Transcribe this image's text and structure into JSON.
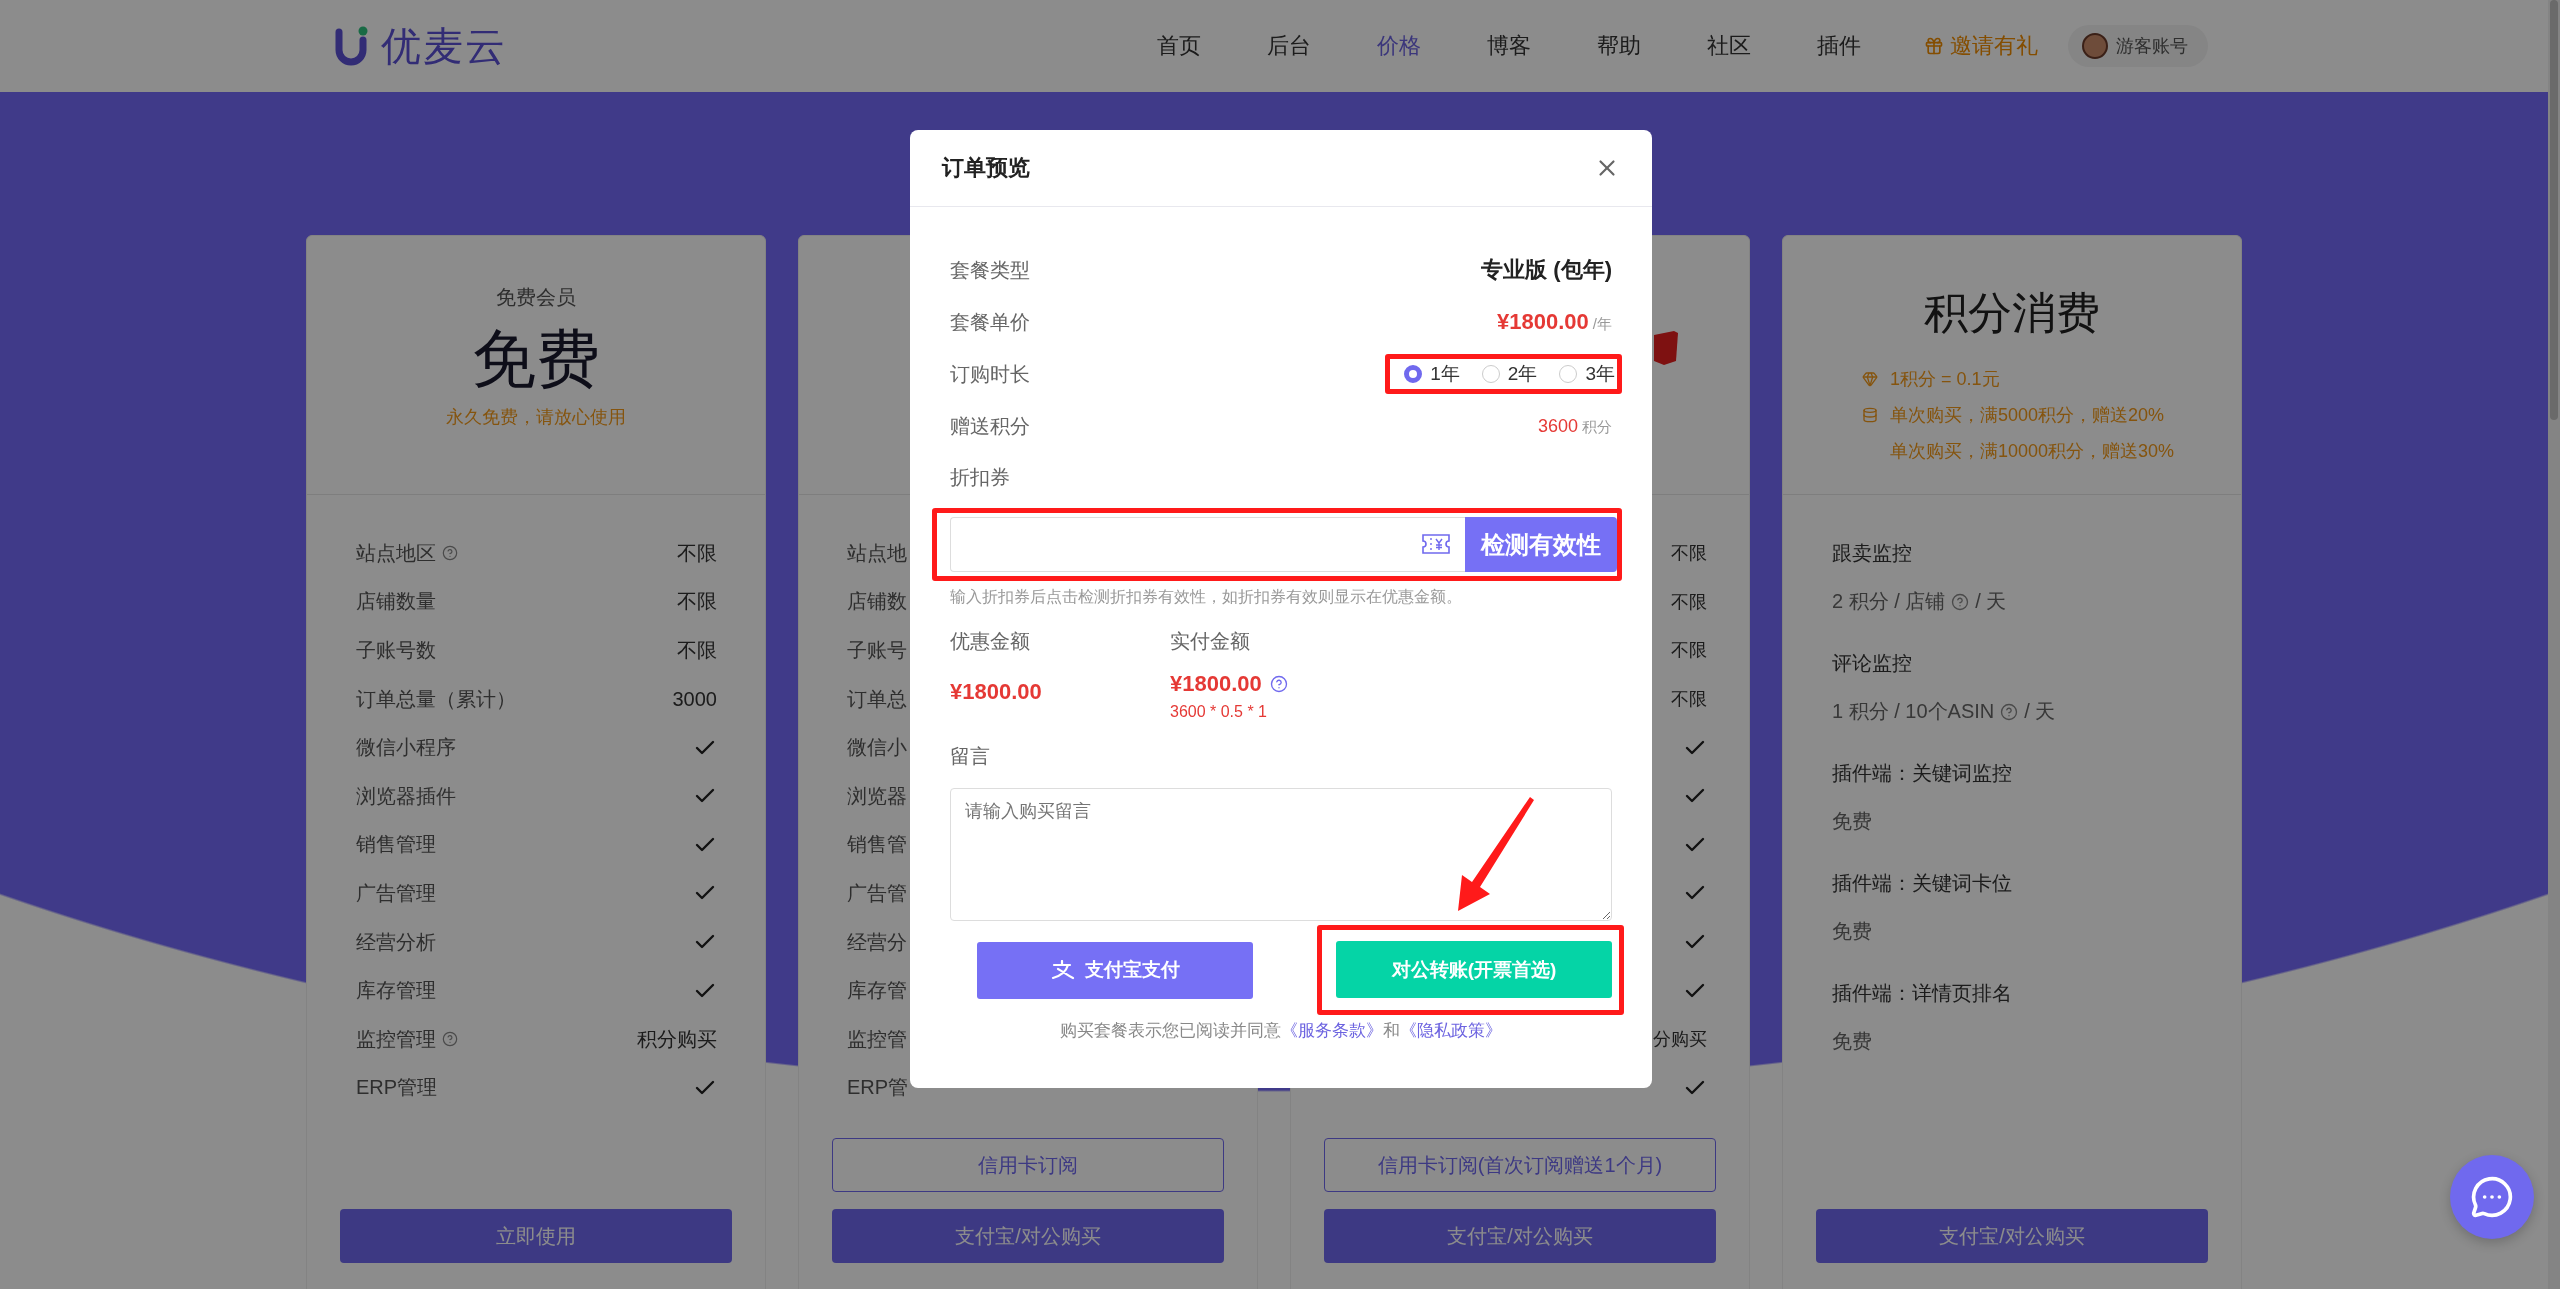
{
  "header": {
    "logo": "优麦云",
    "nav": [
      {
        "label": "首页",
        "selected": false
      },
      {
        "label": "后台",
        "selected": false
      },
      {
        "label": "价格",
        "selected": true
      },
      {
        "label": "博客",
        "selected": false
      },
      {
        "label": "帮助",
        "selected": false
      },
      {
        "label": "社区",
        "selected": false
      },
      {
        "label": "插件",
        "selected": false
      }
    ],
    "invite": "邀请有礼",
    "account": "游客账号"
  },
  "cards": [
    {
      "kind": "plan",
      "title": "免费会员",
      "price": "免费",
      "note": "永久免费，请放心使用",
      "features": [
        {
          "label": "站点地区",
          "help": true,
          "value": "不限"
        },
        {
          "label": "店铺数量",
          "value": "不限"
        },
        {
          "label": "子账号数",
          "value": "不限"
        },
        {
          "label": "订单总量（累计）",
          "value": "3000"
        },
        {
          "label": "微信小程序",
          "check": true
        },
        {
          "label": "浏览器插件",
          "check": true
        },
        {
          "label": "销售管理",
          "check": true
        },
        {
          "label": "广告管理",
          "check": true
        },
        {
          "label": "经营分析",
          "check": true
        },
        {
          "label": "库存管理",
          "check": true
        },
        {
          "label": "监控管理",
          "help": true,
          "value": "积分购买"
        },
        {
          "label": "ERP管理",
          "check": true
        }
      ],
      "buttons": [
        {
          "label": "立即使用",
          "kind": "solid"
        }
      ]
    },
    {
      "kind": "covered_left",
      "features": [
        {
          "label": "站点地"
        },
        {
          "label": "店铺数"
        },
        {
          "label": "子账号"
        },
        {
          "label": "订单总"
        },
        {
          "label": "微信小"
        },
        {
          "label": "浏览器"
        },
        {
          "label": "销售管"
        },
        {
          "label": "广告管"
        },
        {
          "label": "经营分"
        },
        {
          "label": "库存管"
        },
        {
          "label": "监控管"
        },
        {
          "label": "ERP管"
        }
      ],
      "buttons": [
        {
          "label": "信用卡订阅",
          "kind": "outline"
        },
        {
          "label": "支付宝/对公购买",
          "kind": "solid"
        }
      ]
    },
    {
      "kind": "covered_right",
      "ribbon": true,
      "features": [
        {
          "value": "不限"
        },
        {
          "value": "不限"
        },
        {
          "value": "不限"
        },
        {
          "value": "不限"
        },
        {
          "check": true
        },
        {
          "check": true
        },
        {
          "check": true
        },
        {
          "check": true
        },
        {
          "check": true
        },
        {
          "check": true
        },
        {
          "value": "分购买"
        },
        {
          "check": true
        }
      ],
      "buttons": [
        {
          "label": "信用卡订阅(首次订阅赠送1个月)",
          "kind": "outline"
        },
        {
          "label": "支付宝/对公购买",
          "kind": "solid"
        }
      ]
    },
    {
      "kind": "points",
      "title": "积分消费",
      "perks": [
        {
          "kind": "rate",
          "text": "1积分 = 0.1元"
        },
        {
          "kind": "bonus",
          "text": "单次购买，满5000积分，赠送20%"
        },
        {
          "kind": "plain",
          "text": "单次购买，满10000积分，赠送30%"
        }
      ],
      "items": [
        {
          "name": "跟卖监控",
          "price": "2 积分 / 店铺",
          "help": true,
          "unit": "/ 天"
        },
        {
          "name": "评论监控",
          "price": "1 积分 / 10个ASIN",
          "help": true,
          "unit": "/ 天"
        },
        {
          "name": "插件端：关键词监控",
          "price": "免费"
        },
        {
          "name": "插件端：关键词卡位",
          "price": "免费"
        },
        {
          "name": "插件端：详情页排名",
          "price": "免费"
        }
      ],
      "buttons": [
        {
          "label": "支付宝/对公购买",
          "kind": "solid"
        }
      ]
    }
  ],
  "modal": {
    "title": "订单预览",
    "fields": [
      {
        "kind": "text",
        "label": "套餐类型",
        "value": "专业版 (包年)"
      },
      {
        "kind": "price",
        "label": "套餐单价",
        "value": "¥1800.00",
        "unit": "/年"
      },
      {
        "kind": "radio",
        "label": "订购时长",
        "highlighted": true,
        "options": [
          {
            "label": "1年",
            "selected": true
          },
          {
            "label": "2年",
            "selected": false
          },
          {
            "label": "3年",
            "selected": false
          }
        ]
      },
      {
        "kind": "points",
        "label": "赠送积分",
        "value": "3600",
        "unit": "积分"
      }
    ],
    "coupon": {
      "label": "折扣券",
      "highlighted": true,
      "button": "检测有效性",
      "hint": "输入折扣券后点击检测折扣券有效性，如折扣券有效则显示在优惠金额。"
    },
    "amounts": [
      {
        "label": "优惠金额",
        "value": "¥1800.00"
      },
      {
        "label": "实付金额",
        "value": "¥1800.00",
        "help": true,
        "formula": "3600 * 0.5 * 1"
      }
    ],
    "message": {
      "label": "留言",
      "placeholder": "请输入购买留言"
    },
    "actions": [
      {
        "kind": "alipay",
        "label": "支付宝支付",
        "highlighted": false,
        "pointed": false
      },
      {
        "kind": "transfer",
        "label": "对公转账(开票首选)",
        "highlighted": true,
        "pointed": true
      }
    ],
    "terms": {
      "text": "购买套餐表示您已阅读并同意",
      "links": [
        "《服务条款》",
        "《隐私政策》"
      ],
      "joiner": "和"
    }
  }
}
